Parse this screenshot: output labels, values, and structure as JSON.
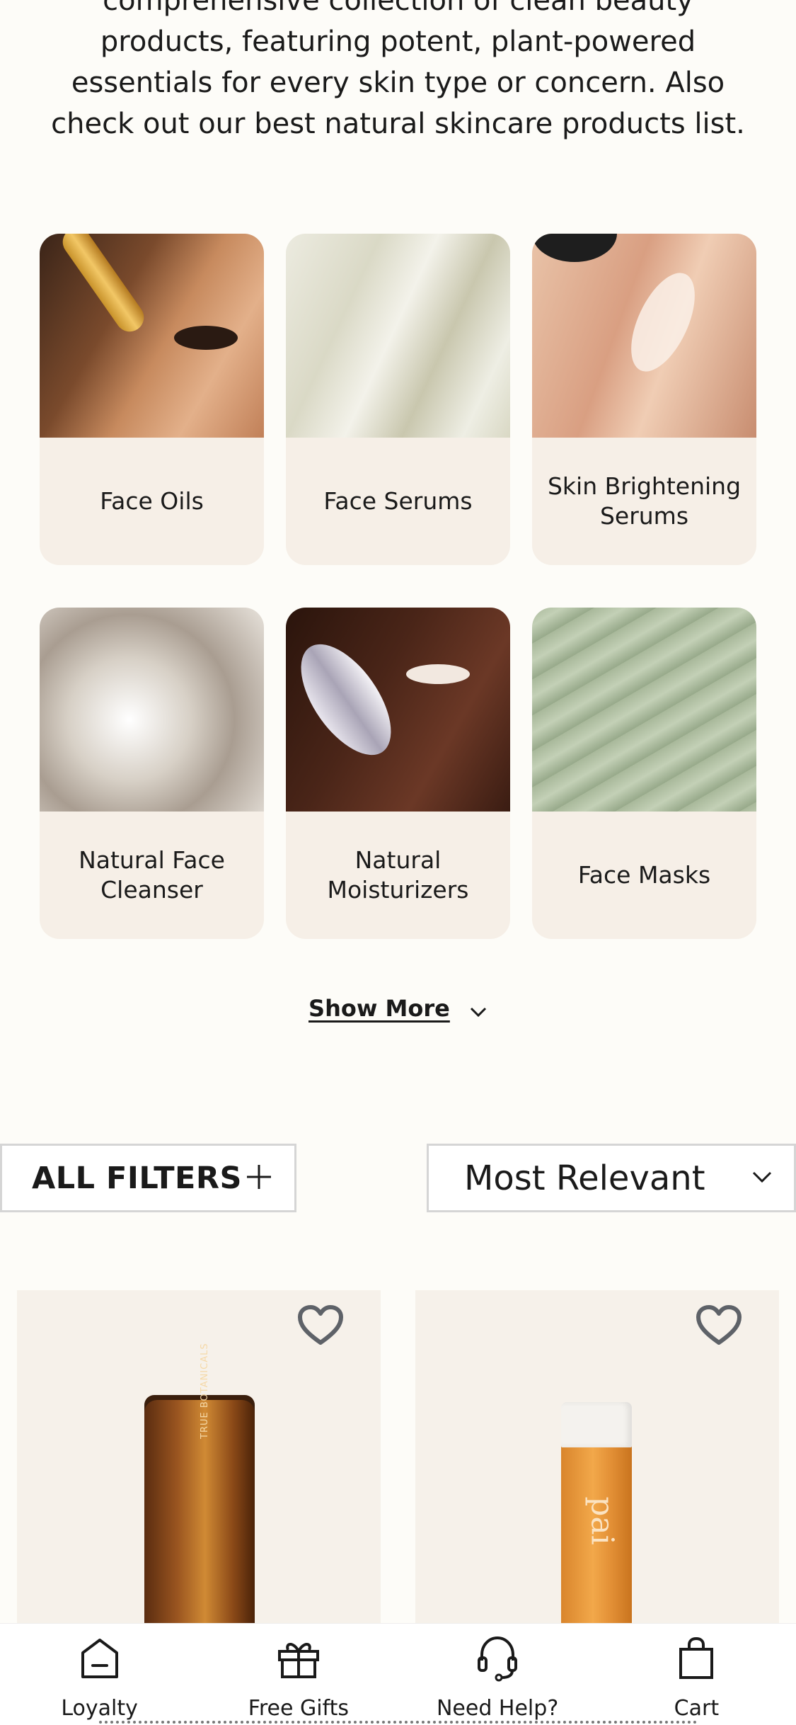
{
  "intro": {
    "text": "comprehensive collection of clean beauty products, featuring potent, plant-powered essentials for every skin type or concern. Also check out our best natural skincare products list."
  },
  "categories": [
    {
      "label": "Face Oils",
      "image": "face-oil-dropper-photo"
    },
    {
      "label": "Face Serums",
      "image": "serum-texture-photo"
    },
    {
      "label": "Skin Brightening Serums",
      "image": "woman-applying-cream-photo"
    },
    {
      "label": "Natural Face Cleanser",
      "image": "cleanser-foam-photo"
    },
    {
      "label": "Natural Moisturizers",
      "image": "moisturizer-swatch-photo"
    },
    {
      "label": "Face Masks",
      "image": "green-clay-mask-photo"
    }
  ],
  "show_more": {
    "label": "Show More",
    "icon": "chevron-down-icon"
  },
  "filters": {
    "label": "ALL FILTERS",
    "icon": "plus-icon"
  },
  "sort": {
    "selected": "Most Relevant",
    "icon": "chevron-down-icon"
  },
  "products": [
    {
      "brand_text": "TRUE BOTANICALS",
      "image": "amber-tube-product",
      "wishlist_icon": "heart-outline-icon"
    },
    {
      "brand_text": "pai",
      "image": "orange-bottle-product",
      "wishlist_icon": "heart-outline-icon"
    }
  ],
  "bottom_nav": [
    {
      "label": "Loyalty",
      "icon": "loyalty-icon"
    },
    {
      "label": "Free Gifts",
      "icon": "gift-icon"
    },
    {
      "label": "Need Help?",
      "icon": "headset-icon"
    },
    {
      "label": "Cart",
      "icon": "shopping-bag-icon"
    }
  ],
  "colors": {
    "page_bg": "#fdfcf8",
    "card_bg": "#f6efe7",
    "product_bg": "#f6f1ea",
    "border": "#d5d5d5",
    "text": "#1a1a1a"
  }
}
